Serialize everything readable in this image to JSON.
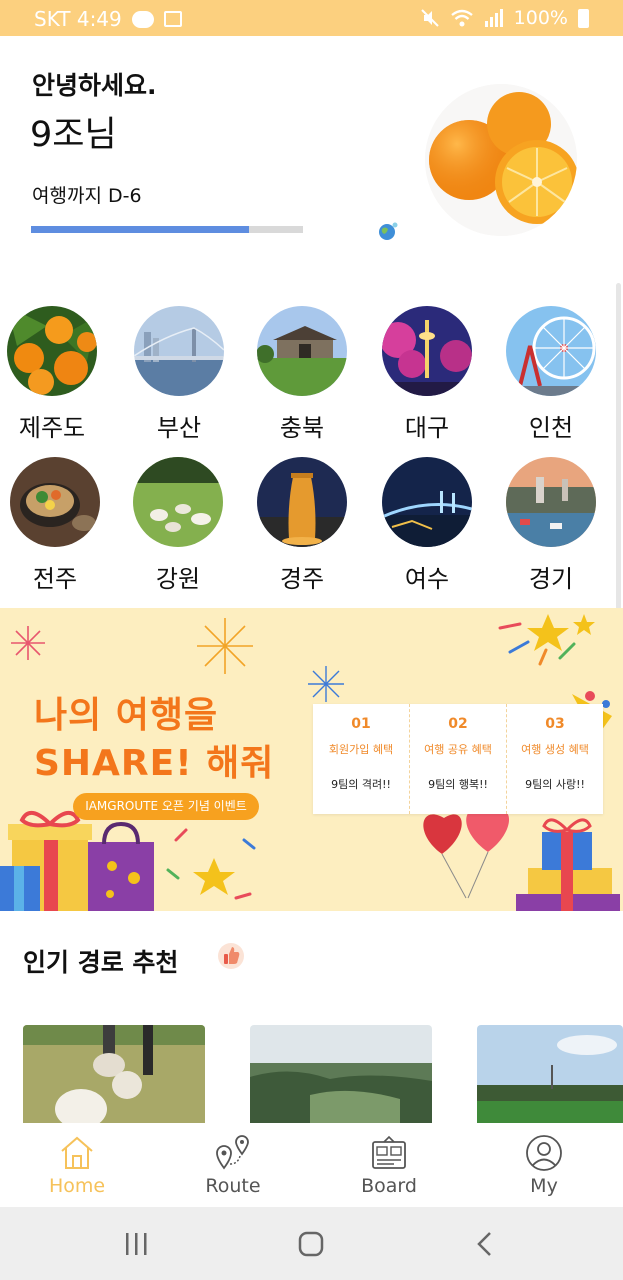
{
  "status_bar": {
    "carrier": "SKT",
    "time": "4:49",
    "battery": "100%",
    "left_icons": [
      "chat-bubble-icon",
      "image-icon"
    ],
    "right_icons": [
      "mute-icon",
      "wifi-icon",
      "signal-icon",
      "battery-icon"
    ]
  },
  "header": {
    "hello": "안녕하세요.",
    "name": "9조님",
    "dday": "여행까지 D-6",
    "progress": 0.8,
    "avatar": "tangerine-photo"
  },
  "regions": [
    {
      "label": "제주도",
      "image": "jeju-tangerines"
    },
    {
      "label": "부산",
      "image": "busan-bridge"
    },
    {
      "label": "충북",
      "image": "chungbuk-fortress"
    },
    {
      "label": "대구",
      "image": "daegu-tower"
    },
    {
      "label": "인천",
      "image": "incheon-ferris-wheel"
    },
    {
      "label": "전주",
      "image": "jeonju-bibimbap"
    },
    {
      "label": "강원",
      "image": "gangwon-sheep"
    },
    {
      "label": "경주",
      "image": "gyeongju-cheomseongdae"
    },
    {
      "label": "여수",
      "image": "yeosu-night-bridge"
    },
    {
      "label": "경기",
      "image": "gyeonggi-park"
    }
  ],
  "banner": {
    "title_line1": "나의 여행을",
    "title_line2": "SHARE! 해줘",
    "pill": "IAMGROUTE 오픈 기념 이벤트",
    "cards": [
      {
        "num": "01",
        "title": "회원가입 혜택",
        "sub": "9팀의 격려!!"
      },
      {
        "num": "02",
        "title": "여행 공유 혜택",
        "sub": "9팀의 행복!!"
      },
      {
        "num": "03",
        "title": "여행 생성 혜택",
        "sub": "9팀의 사랑!!"
      }
    ]
  },
  "popular": {
    "title": "인기 경로 추천",
    "cards": [
      "sheep-field-photo",
      "forest-hills-photo",
      "green-field-photo"
    ]
  },
  "bottom_nav": {
    "items": [
      {
        "label": "Home",
        "icon": "home-icon",
        "active": true
      },
      {
        "label": "Route",
        "icon": "route-pin-icon",
        "active": false
      },
      {
        "label": "Board",
        "icon": "board-icon",
        "active": false
      },
      {
        "label": "My",
        "icon": "user-icon",
        "active": false
      }
    ],
    "active_color": "#f6c25a"
  },
  "system_nav": [
    "recent-apps-icon",
    "home-button-icon",
    "back-icon"
  ],
  "colors": {
    "status_bar": "#fcd07f",
    "progress": "#5e8de0",
    "banner_bg": "#fdeec0",
    "banner_title": "#f3761b"
  }
}
